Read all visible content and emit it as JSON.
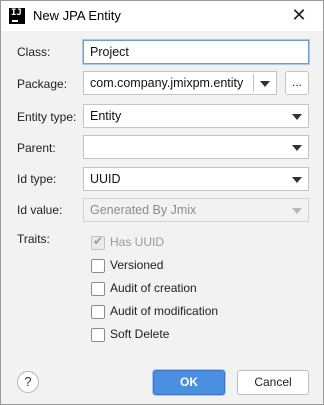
{
  "window": {
    "title": "New JPA Entity",
    "close_glyph": "✕",
    "app_icon_text": "IJ"
  },
  "form": {
    "class_label": "Class:",
    "class_value": "Project",
    "package_label": "Package:",
    "package_value": "com.company.jmixpm.entity",
    "package_browse_label": "...",
    "entity_type_label": "Entity type:",
    "entity_type_value": "Entity",
    "parent_label": "Parent:",
    "parent_value": "",
    "id_type_label": "Id type:",
    "id_type_value": "UUID",
    "id_value_label": "Id value:",
    "id_value_value": "Generated By Jmix",
    "traits_label": "Traits:"
  },
  "traits": [
    {
      "label": "Has UUID",
      "checked": true,
      "disabled": true
    },
    {
      "label": "Versioned",
      "checked": false,
      "disabled": false
    },
    {
      "label": "Audit of creation",
      "checked": false,
      "disabled": false
    },
    {
      "label": "Audit of modification",
      "checked": false,
      "disabled": false
    },
    {
      "label": "Soft Delete",
      "checked": false,
      "disabled": false
    }
  ],
  "footer": {
    "help_label": "?",
    "ok_label": "OK",
    "cancel_label": "Cancel"
  },
  "colors": {
    "accent": "#4a8fe0",
    "focus_border": "#6d9fd1",
    "background": "#f2f2f2"
  }
}
